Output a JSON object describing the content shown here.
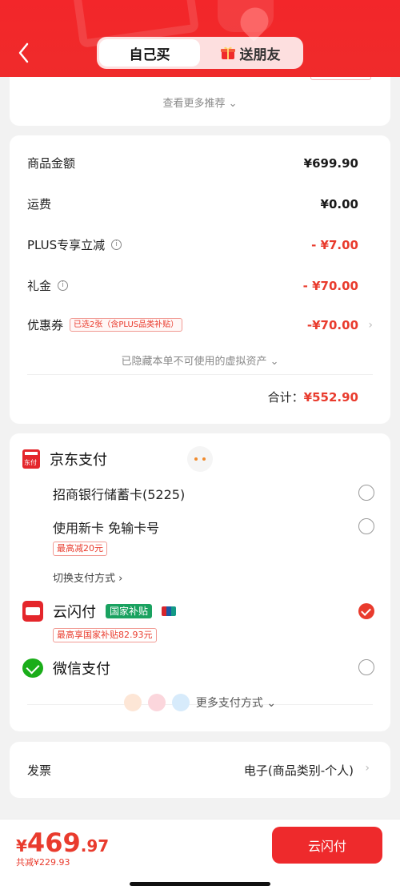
{
  "header": {
    "tab_self": "自己买",
    "tab_gift": "送朋友",
    "accent_color": "#ef2b2b"
  },
  "recommend": {
    "more_label": "查看更多推荐 ⌄"
  },
  "summary": {
    "goods_amount_label": "商品金额",
    "goods_amount_value": "¥699.90",
    "shipping_label": "运费",
    "shipping_value": "¥0.00",
    "plus_label": "PLUS专享立减",
    "plus_value": "- ¥7.00",
    "gift_money_label": "礼金",
    "gift_money_value": "- ¥70.00",
    "coupon_label": "优惠券",
    "coupon_tag": "已选2张（含PLUS品类补贴）",
    "coupon_value": "-¥70.00",
    "hidden_note": "已隐藏本单不可使用的虚拟资产 ⌄",
    "total_label": "合计：",
    "total_value": "¥552.90"
  },
  "payment": {
    "jd_pay_label": "京东支付",
    "jd_logo_text": "东付",
    "card_cmb": "招商银行储蓄卡(5225)",
    "new_card": "使用新卡 免输卡号",
    "new_card_promo": "最高减20元",
    "switch_label": "切换支付方式 ›",
    "yunshanfu_label": "云闪付",
    "gov_tag": "国家补贴",
    "yunshanfu_promo": "最高享国家补贴82.93元",
    "wechat_label": "微信支付",
    "more_pay_label": "更多支付方式 ⌄",
    "selected": "云闪付"
  },
  "invoice": {
    "label": "发票",
    "value": "电子(商品类别-个人)"
  },
  "footer": {
    "currency": "¥",
    "price_int": "469",
    "price_dec": ".97",
    "saved": "共减¥229.93",
    "pay_button": "云闪付"
  }
}
